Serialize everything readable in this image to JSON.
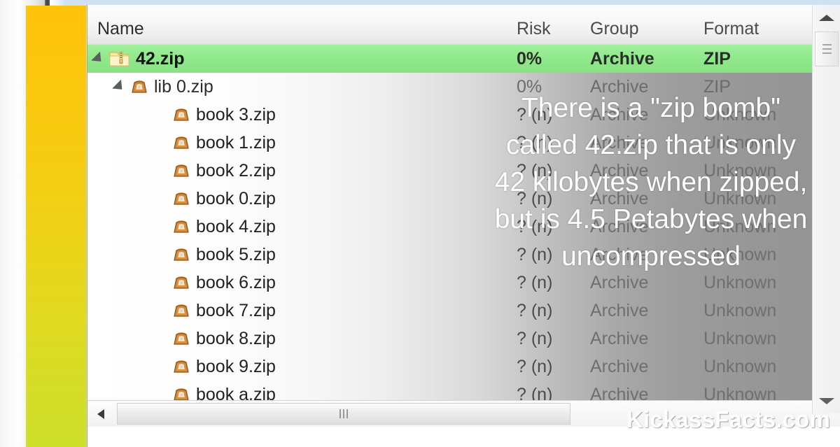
{
  "window": {
    "accent_yellow": "#ffc20a",
    "accent_green_panel": "#cfe02b",
    "selection_green": "#8fe98c",
    "frame_blue": "#c3dcf2"
  },
  "columns": {
    "name": "Name",
    "risk": "Risk",
    "group": "Group",
    "format": "Format"
  },
  "rows": [
    {
      "level": 0,
      "icon": "folder-zip-icon",
      "expander": "expanded",
      "name": "42.zip",
      "risk": "0%",
      "group": "Archive",
      "format": "ZIP",
      "selected": true
    },
    {
      "level": 1,
      "icon": "archive-zip-icon",
      "expander": "expanded",
      "name": "lib 0.zip",
      "risk": "0%",
      "group": "Archive",
      "format": "ZIP",
      "selected": false
    },
    {
      "level": 2,
      "icon": "archive-zip-icon",
      "expander": "none",
      "name": "book 3.zip",
      "risk": "? (n)",
      "group": "Archive",
      "format": "Unknown",
      "selected": false
    },
    {
      "level": 2,
      "icon": "archive-zip-icon",
      "expander": "none",
      "name": "book 1.zip",
      "risk": "? (n)",
      "group": "Archive",
      "format": "Unknown",
      "selected": false
    },
    {
      "level": 2,
      "icon": "archive-zip-icon",
      "expander": "none",
      "name": "book 2.zip",
      "risk": "? (n)",
      "group": "Archive",
      "format": "Unknown",
      "selected": false
    },
    {
      "level": 2,
      "icon": "archive-zip-icon",
      "expander": "none",
      "name": "book 0.zip",
      "risk": "? (n)",
      "group": "Archive",
      "format": "Unknown",
      "selected": false
    },
    {
      "level": 2,
      "icon": "archive-zip-icon",
      "expander": "none",
      "name": "book 4.zip",
      "risk": "? (n)",
      "group": "Archive",
      "format": "Unknown",
      "selected": false
    },
    {
      "level": 2,
      "icon": "archive-zip-icon",
      "expander": "none",
      "name": "book 5.zip",
      "risk": "? (n)",
      "group": "Archive",
      "format": "Unknown",
      "selected": false
    },
    {
      "level": 2,
      "icon": "archive-zip-icon",
      "expander": "none",
      "name": "book 6.zip",
      "risk": "? (n)",
      "group": "Archive",
      "format": "Unknown",
      "selected": false
    },
    {
      "level": 2,
      "icon": "archive-zip-icon",
      "expander": "none",
      "name": "book 7.zip",
      "risk": "? (n)",
      "group": "Archive",
      "format": "Unknown",
      "selected": false
    },
    {
      "level": 2,
      "icon": "archive-zip-icon",
      "expander": "none",
      "name": "book 8.zip",
      "risk": "? (n)",
      "group": "Archive",
      "format": "Unknown",
      "selected": false
    },
    {
      "level": 2,
      "icon": "archive-zip-icon",
      "expander": "none",
      "name": "book 9.zip",
      "risk": "? (n)",
      "group": "Archive",
      "format": "Unknown",
      "selected": false
    },
    {
      "level": 2,
      "icon": "archive-zip-icon",
      "expander": "none",
      "name": "book a.zip",
      "risk": "? (n)",
      "group": "Archive",
      "format": "Unknown",
      "selected": false
    }
  ],
  "caption": {
    "lines": [
      "There is a \"zip bomb\"",
      "called 42.zip that is only",
      "42 kilobytes when zipped,",
      "but is 4.5 Petabytes when",
      "uncompressed"
    ],
    "color": "#ffffff"
  },
  "watermark": {
    "text": "KickassFacts.com"
  },
  "scrollbars": {
    "horizontal": {
      "left_arrow": "arrow-left-icon",
      "grip": "grip-icon"
    },
    "vertical": {
      "up_arrow": "arrow-up-icon",
      "down_arrow": "arrow-down-icon",
      "grip": "grip-icon"
    }
  }
}
